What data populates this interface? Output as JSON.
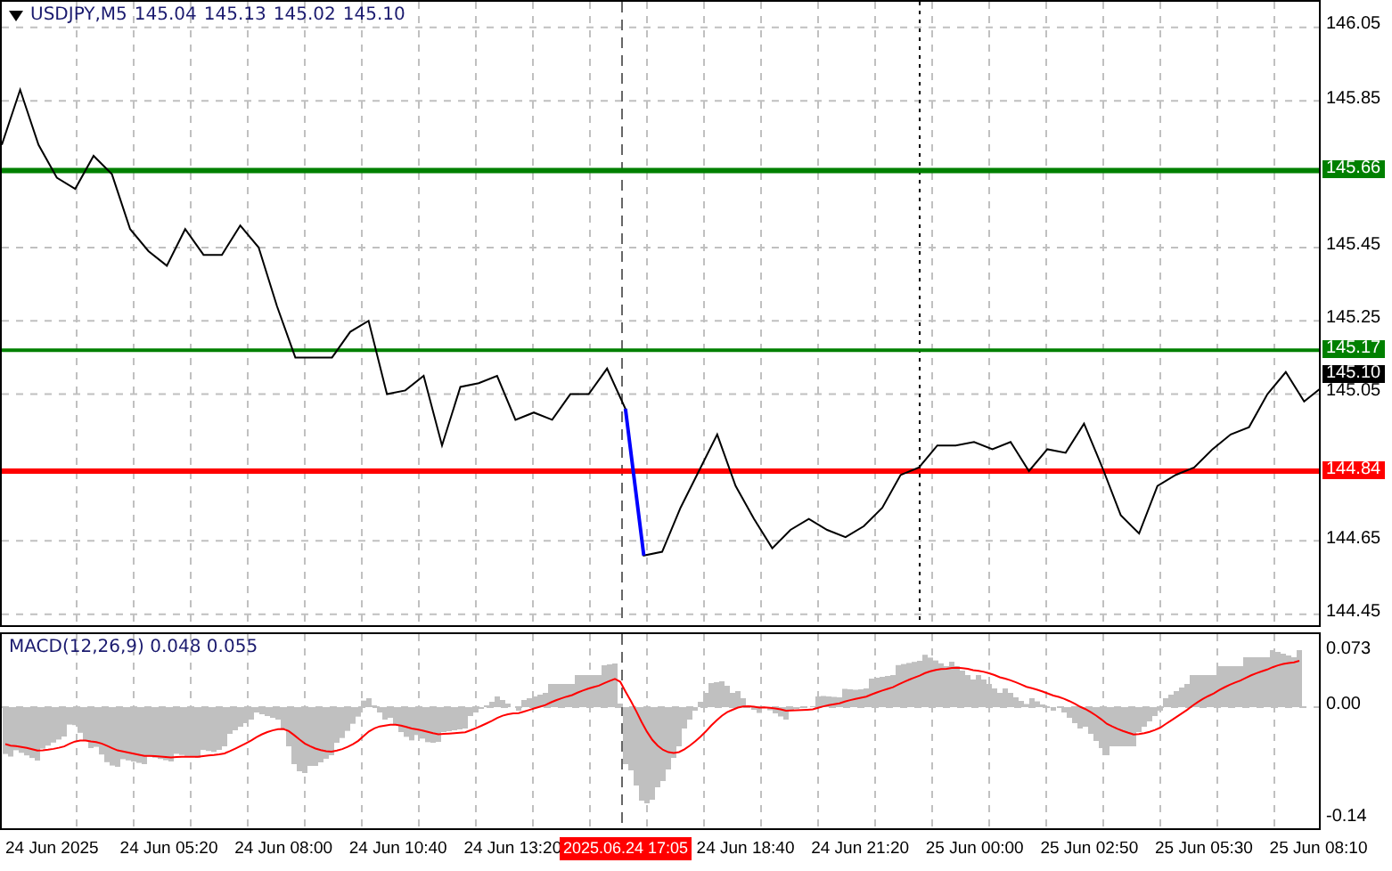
{
  "header": {
    "symbol": "USDJPY,M5",
    "values": [
      "145.04",
      "145.13",
      "145.02",
      "145.10"
    ]
  },
  "chart_data": {
    "type": "line",
    "grid": true,
    "ylim": [
      144.42,
      146.12
    ],
    "yticks": [
      {
        "value": 146.05,
        "label": "146.05"
      },
      {
        "value": 145.85,
        "label": "145.85"
      },
      {
        "value": 145.45,
        "label": "145.45"
      },
      {
        "value": 145.25,
        "label": "145.25"
      },
      {
        "value": 145.05,
        "label": "145.05"
      },
      {
        "value": 144.65,
        "label": "144.65"
      },
      {
        "value": 144.45,
        "label": "144.45"
      }
    ],
    "series": [
      {
        "color": "#000000",
        "values": [
          145.73,
          145.88,
          145.73,
          145.64,
          145.61,
          145.7,
          145.65,
          145.5,
          145.44,
          145.4,
          145.5,
          145.43,
          145.43,
          145.51,
          145.45,
          145.29,
          145.15,
          145.15,
          145.15,
          145.22,
          145.25,
          145.05,
          145.06,
          145.1,
          144.91,
          145.07,
          145.08,
          145.1,
          144.98,
          145.0,
          144.98,
          145.05,
          145.05,
          145.12,
          145.01,
          144.61,
          144.62,
          144.74,
          144.84,
          144.94,
          144.8,
          144.71,
          144.63,
          144.68,
          144.71,
          144.68,
          144.66,
          144.69,
          144.74,
          144.83,
          144.85,
          144.91,
          144.91,
          144.92,
          144.9,
          144.92,
          144.84,
          144.9,
          144.89,
          144.97,
          144.85,
          144.72,
          144.67,
          144.8,
          144.83,
          144.85,
          144.9,
          144.94,
          144.96,
          145.05,
          145.11,
          145.03,
          145.07
        ]
      },
      {
        "color": "#0000ff",
        "values": [
          null,
          null,
          null,
          null,
          null,
          null,
          null,
          null,
          null,
          null,
          null,
          null,
          null,
          null,
          null,
          null,
          null,
          null,
          null,
          null,
          null,
          null,
          null,
          null,
          null,
          null,
          null,
          null,
          null,
          null,
          null,
          null,
          null,
          null,
          145.01,
          144.61,
          null,
          null,
          null,
          null,
          null,
          null,
          null,
          null,
          null,
          null,
          null,
          null,
          null,
          null,
          null,
          null,
          null,
          null,
          null,
          null,
          null,
          null,
          null,
          null,
          null,
          null,
          null,
          null,
          null,
          null,
          null,
          null,
          null,
          null,
          null,
          null,
          null
        ]
      },
      {
        "color": "#008000",
        "values": [
          145.66,
          145.66,
          145.66,
          145.66,
          145.66,
          145.66,
          145.66,
          145.66,
          145.66,
          145.66,
          145.66,
          145.66,
          145.66,
          145.66,
          145.66,
          145.66,
          145.66,
          145.66,
          145.66,
          145.66,
          145.66,
          145.66,
          145.66,
          145.66,
          145.66,
          145.66,
          145.66,
          145.66,
          145.66,
          145.66,
          145.66,
          145.66,
          145.66,
          145.66,
          145.66,
          145.66,
          145.66,
          145.66,
          145.66,
          145.66,
          145.66,
          145.66,
          145.66,
          145.66,
          145.66,
          145.66,
          145.66,
          145.66,
          145.66,
          145.66,
          145.66,
          145.66,
          145.66,
          145.66,
          145.66,
          145.66,
          145.66,
          145.66,
          145.66,
          145.66,
          145.66,
          145.66,
          145.66,
          145.66,
          145.66,
          145.66,
          145.66,
          145.66,
          145.66,
          145.66,
          145.66,
          145.66,
          145.66
        ]
      },
      {
        "color": "#008000",
        "values": [
          145.17,
          145.17,
          145.17,
          145.17,
          145.17,
          145.17,
          145.17,
          145.17,
          145.17,
          145.17,
          145.17,
          145.17,
          145.17,
          145.17,
          145.17,
          145.17,
          145.17,
          145.17,
          145.17,
          145.17,
          145.17,
          145.17,
          145.17,
          145.17,
          145.17,
          145.17,
          145.17,
          145.17,
          145.17,
          145.17,
          145.17,
          145.17,
          145.17,
          145.17,
          145.17,
          145.17,
          145.17,
          145.17,
          145.17,
          145.17,
          145.17,
          145.17,
          145.17,
          145.17,
          145.17,
          145.17,
          145.17,
          145.17,
          145.17,
          145.17,
          145.17,
          145.17,
          145.17,
          145.17,
          145.17,
          145.17,
          145.17,
          145.17,
          145.17,
          145.17,
          145.17,
          145.17,
          145.17,
          145.17,
          145.17,
          145.17,
          145.17,
          145.17,
          145.17,
          145.17,
          145.17,
          145.17,
          145.17
        ]
      },
      {
        "color": "#ff0000",
        "values": [
          144.84,
          144.84,
          144.84,
          144.84,
          144.84,
          144.84,
          144.84,
          144.84,
          144.84,
          144.84,
          144.84,
          144.84,
          144.84,
          144.84,
          144.84,
          144.84,
          144.84,
          144.84,
          144.84,
          144.84,
          144.84,
          144.84,
          144.84,
          144.84,
          144.84,
          144.84,
          144.84,
          144.84,
          144.84,
          144.84,
          144.84,
          144.84,
          144.84,
          144.84,
          144.84,
          144.84,
          144.84,
          144.84,
          144.84,
          144.84,
          144.84,
          144.84,
          144.84,
          144.84,
          144.84,
          144.84,
          144.84,
          144.84,
          144.84,
          144.84,
          144.84,
          144.84,
          144.84,
          144.84,
          144.84,
          144.84,
          144.84,
          144.84,
          144.84,
          144.84,
          144.84,
          144.84,
          144.84,
          144.84,
          144.84,
          144.84,
          144.84,
          144.84,
          144.84,
          144.84,
          144.84,
          144.84,
          144.84
        ]
      }
    ]
  },
  "levels": [
    {
      "label": "145.66",
      "color": "#008000",
      "kind": "thick"
    },
    {
      "label": "145.17",
      "color": "#008000",
      "kind": "thin"
    },
    {
      "label": "144.84",
      "color": "#ff0000",
      "kind": "thick"
    }
  ],
  "current_price": {
    "label": "145.10"
  },
  "macd": {
    "title": "MACD(12,26,9) 0.048 0.055",
    "axis": [
      "0.073",
      "0.00",
      "-0.14"
    ]
  },
  "time_axis": [
    "24 Jun 2025",
    "24 Jun 05:20",
    "24 Jun 08:00",
    "24 Jun 10:40",
    "24 Jun 13:20",
    "24 Jun 18:40",
    "24 Jun 21:20",
    "25 Jun 00:00",
    "25 Jun 02:50",
    "25 Jun 05:30",
    "25 Jun 08:10"
  ],
  "crosshair": {
    "label": "2025.06.24 17:05"
  }
}
